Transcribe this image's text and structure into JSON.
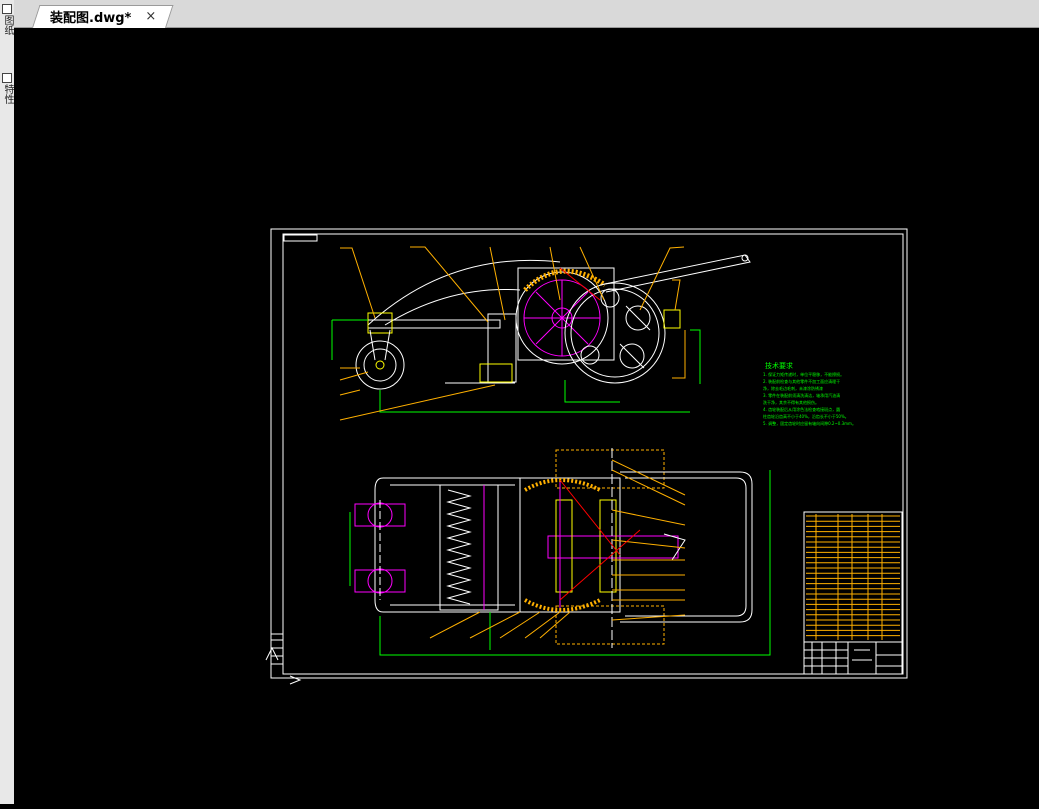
{
  "document_tab": {
    "title": "装配图.dwg*",
    "close_glyph": "×"
  },
  "side_panel": {
    "tab1": "图纸",
    "tab2": "特性"
  },
  "drawing": {
    "notes_heading": "技术要求",
    "notes": [
      "1. 保证力矩传递时，单位平稳移，不能擦损。",
      "2. 装配前检查与其他零件不加工面应清理干",
      "净，除去毛边毛刺，未漆涂防锈漆",
      "3. 零件在装配前须清洗清洁，轴承用汽油清",
      "洗干净，其余不得有其他损伤。",
      "4. 齿轮装配后从用涂色法检查啮接斑点，圆",
      "柱齿轮沿齿高不小于40%，沿齿长不小于50%。",
      "5. 调整，固定齿轮时应留有轴向间隙0.2~0.3mm。"
    ],
    "colors": {
      "frame": "#ffffff",
      "leader": "#ffb000",
      "yellow": "#ffff00",
      "magenta": "#ff00ff",
      "green": "#00ff00",
      "cyan": "#00ffff",
      "red": "#ff0000"
    }
  }
}
